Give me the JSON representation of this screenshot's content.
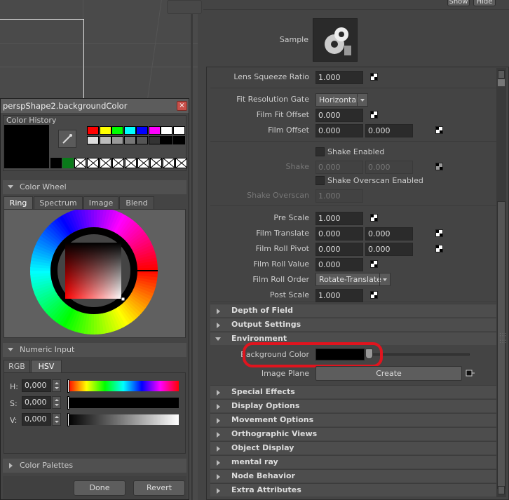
{
  "dialog": {
    "title": "perspShape2.backgroundColor",
    "color_history": "Color History",
    "color_wheel": "Color Wheel",
    "tabs": [
      "Ring",
      "Spectrum",
      "Image",
      "Blend"
    ],
    "numeric_input": "Numeric Input",
    "num_tabs": [
      "RGB",
      "HSV"
    ],
    "h_label": "H:",
    "s_label": "S:",
    "v_label": "V:",
    "h_value": "0,000",
    "s_value": "0,000",
    "v_value": "0,000",
    "color_palettes": "Color Palettes",
    "done": "Done",
    "revert": "Revert",
    "history_colors": [
      "#ff0000",
      "#ffff00",
      "#00ff00",
      "#00ffff",
      "#0000ff",
      "#ff00ff",
      "#ffffff",
      "#ffffff",
      "#dddddd",
      "#bbbbbb",
      "#999999",
      "#777777",
      "#555555",
      "#333333",
      "#000000",
      "#000000"
    ]
  },
  "panel": {
    "show": "Show",
    "hide": "Hide",
    "sample": "Sample",
    "lens_squeeze": {
      "label": "Lens Squeeze Ratio",
      "value": "1.000"
    },
    "fit_gate": {
      "label": "Fit Resolution Gate",
      "value": "Horizontal"
    },
    "film_fit_offset": {
      "label": "Film Fit Offset",
      "value": "0.000"
    },
    "film_offset": {
      "label": "Film Offset",
      "v1": "0.000",
      "v2": "0.000"
    },
    "shake_enabled": "Shake Enabled",
    "shake": {
      "label": "Shake",
      "v1": "0.000",
      "v2": "0.000"
    },
    "shake_overscan_enabled": "Shake Overscan Enabled",
    "shake_overscan": {
      "label": "Shake Overscan",
      "value": "1.000"
    },
    "pre_scale": {
      "label": "Pre Scale",
      "value": "1.000"
    },
    "film_translate": {
      "label": "Film Translate",
      "v1": "0.000",
      "v2": "0.000"
    },
    "film_roll_pivot": {
      "label": "Film Roll Pivot",
      "v1": "0.000",
      "v2": "0.000"
    },
    "film_roll_value": {
      "label": "Film Roll Value",
      "value": "0.000"
    },
    "film_roll_order": {
      "label": "Film Roll Order",
      "value": "Rotate-Translate"
    },
    "post_scale": {
      "label": "Post Scale",
      "value": "1.000"
    },
    "sections_top": [
      "Depth of Field",
      "Output Settings",
      "Environment"
    ],
    "background_color": "Background Color",
    "image_plane": "Image Plane",
    "create": "Create",
    "sections_bottom": [
      "Special Effects",
      "Display Options",
      "Movement Options",
      "Orthographic Views",
      "Object Display",
      "mental ray",
      "Node Behavior",
      "Extra Attributes"
    ]
  },
  "colors": {
    "highlight": "#e0141e",
    "bg_color_value": "#000000"
  }
}
